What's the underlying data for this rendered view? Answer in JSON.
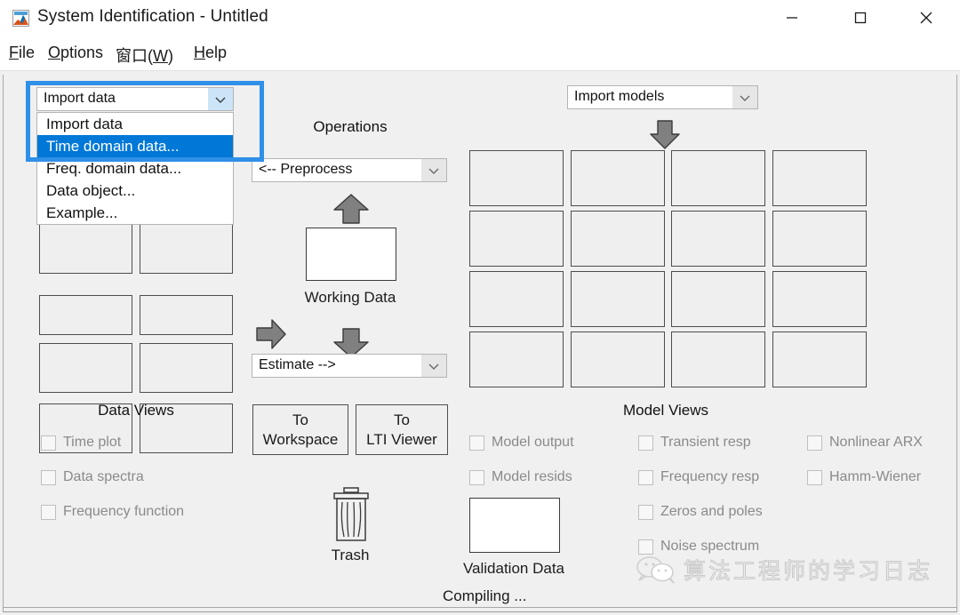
{
  "window": {
    "title": "System Identification - Untitled",
    "icon": "matlab-icon",
    "minimize": "─",
    "maximize": "□",
    "close": "✕"
  },
  "menubar": {
    "items": [
      {
        "label": "File",
        "mnemonic": "F"
      },
      {
        "label": "Options",
        "mnemonic": "O"
      },
      {
        "label": "窗口(W)",
        "mnemonic": "W"
      },
      {
        "label": "Help",
        "mnemonic": "H"
      }
    ]
  },
  "data_panel": {
    "import_combo": {
      "value": "Import data",
      "open": true,
      "options": [
        {
          "label": "Import data",
          "selected": false
        },
        {
          "label": "Time domain data...",
          "selected": true
        },
        {
          "label": "Freq. domain data...",
          "selected": false
        },
        {
          "label": "Data object...",
          "selected": false
        },
        {
          "label": "Example...",
          "selected": false
        }
      ]
    },
    "views_title": "Data Views",
    "views": [
      {
        "label": "Time plot",
        "checked": false
      },
      {
        "label": "Data spectra",
        "checked": false
      },
      {
        "label": "Frequency function",
        "checked": false
      }
    ]
  },
  "operations": {
    "title": "Operations",
    "preprocess_combo": {
      "value": "<-- Preprocess"
    },
    "estimate_combo": {
      "value": "Estimate -->"
    },
    "working_data_label": "Working Data",
    "buttons": [
      {
        "line1": "To",
        "line2": "Workspace"
      },
      {
        "line1": "To",
        "line2": "LTI Viewer"
      }
    ],
    "trash_label": "Trash",
    "trash_icon": "trash-icon"
  },
  "models_panel": {
    "import_combo": {
      "value": "Import models"
    },
    "views_title": "Model Views",
    "validation_data_label": "Validation Data",
    "views_column1": [
      {
        "label": "Model output",
        "checked": false
      },
      {
        "label": "Model resids",
        "checked": false
      }
    ],
    "views_column2": [
      {
        "label": "Transient resp",
        "checked": false
      },
      {
        "label": "Frequency resp",
        "checked": false
      },
      {
        "label": "Zeros and poles",
        "checked": false
      },
      {
        "label": "Noise spectrum",
        "checked": false
      }
    ],
    "views_column3": [
      {
        "label": "Nonlinear ARX",
        "checked": false
      },
      {
        "label": "Hamm-Wiener",
        "checked": false
      }
    ]
  },
  "status": {
    "text": "Compiling ..."
  },
  "watermark": {
    "text": "算法工程师的学习日志",
    "icon": "wechat-icon"
  },
  "colors": {
    "highlight": "#0078d7",
    "annotation": "#2f90e8",
    "window_bg": "#f0f0f0"
  }
}
